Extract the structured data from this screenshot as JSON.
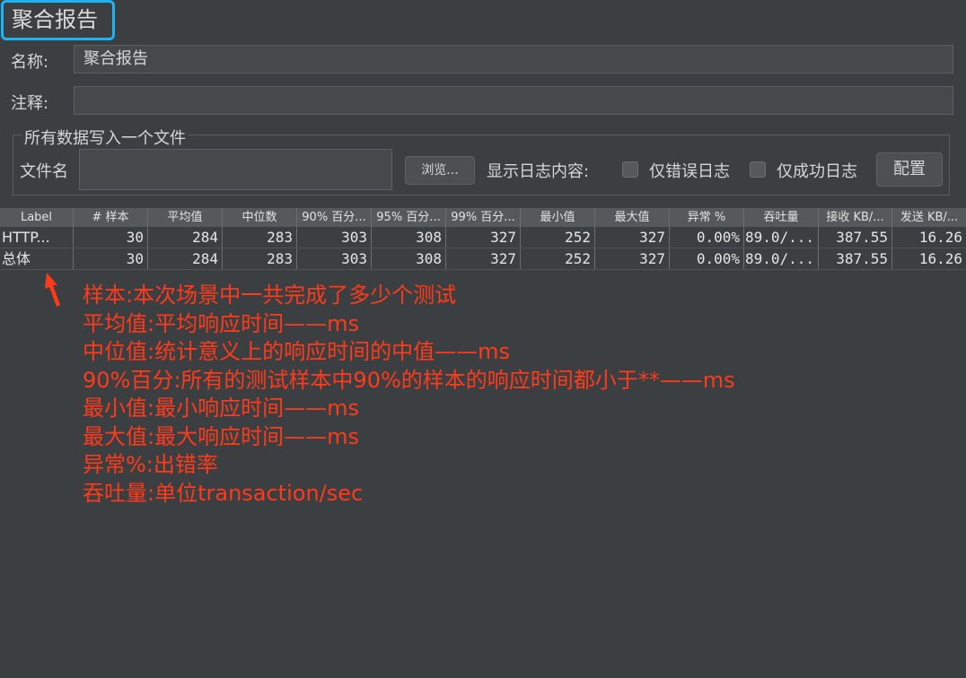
{
  "title": "聚合报告",
  "fields": {
    "name_label": "名称:",
    "name_value": "聚合报告",
    "comment_label": "注释:",
    "comment_value": ""
  },
  "file_group": {
    "title": "所有数据写入一个文件",
    "filename_label": "文件名",
    "browse_button": "浏览...",
    "log_content_label": "显示日志内容:",
    "errors_only": "仅错误日志",
    "success_only": "仅成功日志",
    "config_button": "配置"
  },
  "table": {
    "headers": [
      "Label",
      "# 样本",
      "平均值",
      "中位数",
      "90% 百分...",
      "95% 百分...",
      "99% 百分...",
      "最小值",
      "最大值",
      "异常 %",
      "吞吐量",
      "接收 KB/...",
      "发送 KB/..."
    ],
    "rows": [
      [
        "HTTP...",
        "30",
        "284",
        "283",
        "303",
        "308",
        "327",
        "252",
        "327",
        "0.00%",
        "89.0/...",
        "387.55",
        "16.26"
      ],
      [
        "总体",
        "30",
        "284",
        "283",
        "303",
        "308",
        "327",
        "252",
        "327",
        "0.00%",
        "89.0/...",
        "387.55",
        "16.26"
      ]
    ]
  },
  "annotations": [
    "样本:本次场景中一共完成了多少个测试",
    "平均值:平均响应时间——ms",
    "中位值:统计意义上的响应时间的中值——ms",
    "90%百分:所有的测试样本中90%的样本的响应时间都小于**——ms",
    "最小值:最小响应时间——ms",
    "最大值:最大响应时间——ms",
    "异常%:出错率",
    "吞吐量:单位transaction/sec"
  ],
  "colors": {
    "background": "#3c3f41",
    "highlight_border": "#1eb3f0",
    "annotation": "#ff3a1a"
  },
  "icons": {
    "arrow": "arrow-up-icon"
  }
}
